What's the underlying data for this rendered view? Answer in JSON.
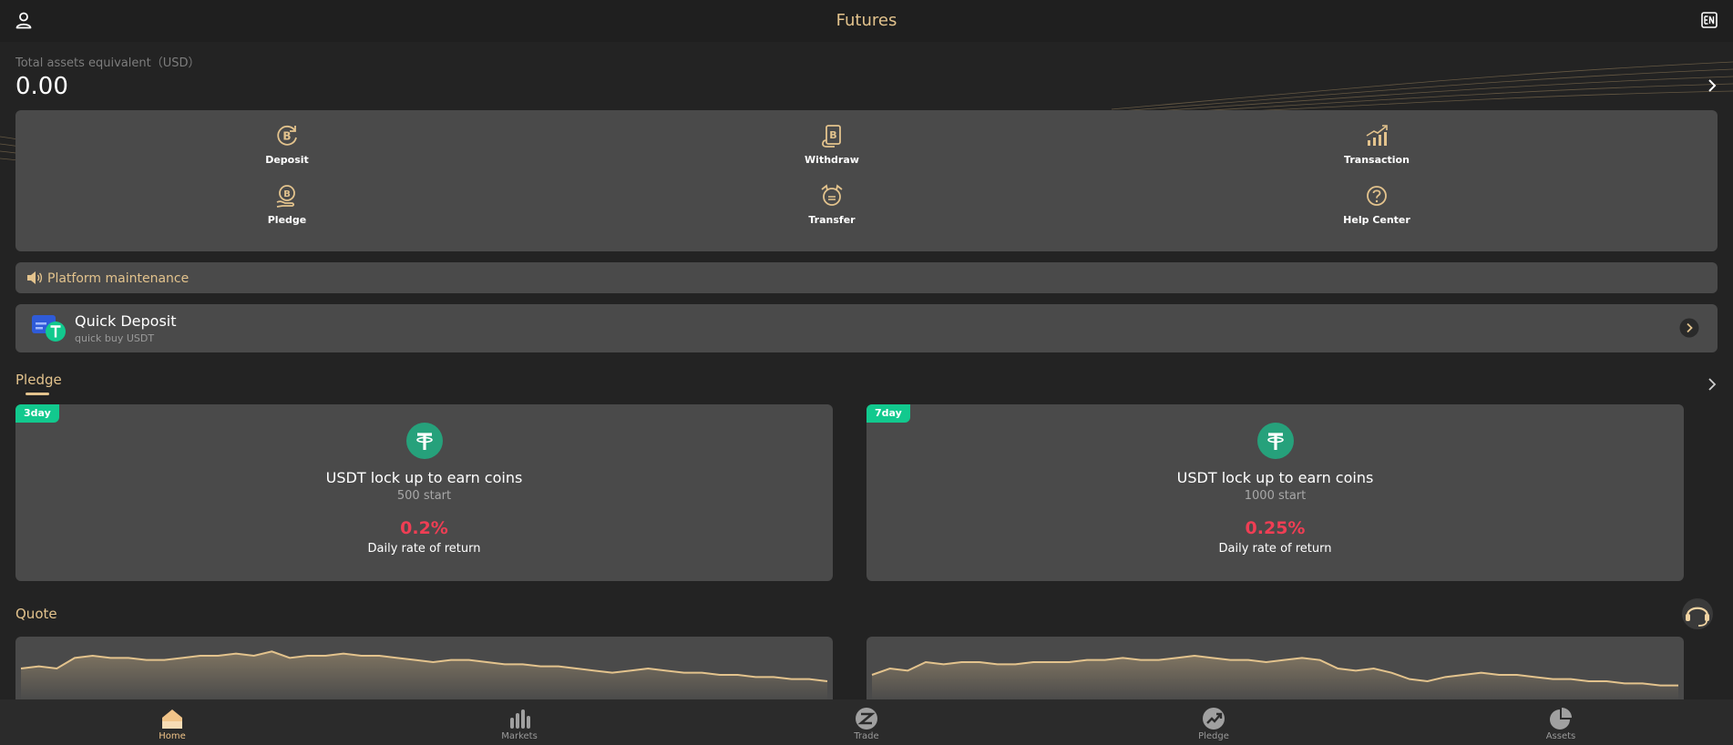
{
  "header": {
    "title": "Futures"
  },
  "assets": {
    "label": "Total assets equivalent（USD）",
    "value": "0.00"
  },
  "menu": {
    "items": [
      {
        "label": "Deposit",
        "icon": "bitcoin-refresh-icon"
      },
      {
        "label": "Withdraw",
        "icon": "bitcoin-wallet-icon"
      },
      {
        "label": "Transaction",
        "icon": "trend-chart-icon"
      },
      {
        "label": "Pledge",
        "icon": "bitcoin-hand-icon"
      },
      {
        "label": "Transfer",
        "icon": "transfer-cycle-icon"
      },
      {
        "label": "Help Center",
        "icon": "question-circle-icon"
      }
    ]
  },
  "notice": {
    "text": "Platform maintenance"
  },
  "quick_deposit": {
    "title": "Quick Deposit",
    "subtitle": "quick buy USDT"
  },
  "pledge": {
    "title": "Pledge",
    "cards": [
      {
        "tag": "3day",
        "title": "USDT lock up to earn coins",
        "subtitle": "500 start",
        "rate": "0.2%",
        "rate_label": "Daily rate of return"
      },
      {
        "tag": "7day",
        "title": "USDT lock up to earn coins",
        "subtitle": "1000 start",
        "rate": "0.25%",
        "rate_label": "Daily rate of return"
      }
    ]
  },
  "quote": {
    "title": "Quote",
    "sparklines": [
      {
        "values": [
          30,
          31,
          30,
          35,
          36,
          35,
          35,
          34,
          34,
          35,
          36,
          36,
          37,
          36,
          38,
          35,
          36,
          36,
          37,
          36,
          36,
          35,
          34,
          33,
          34,
          34,
          33,
          32,
          32,
          31,
          31,
          30,
          29,
          28,
          29,
          30,
          29,
          28,
          28,
          27,
          27,
          26,
          26,
          25,
          25,
          24
        ]
      },
      {
        "values": [
          27,
          30,
          29,
          33,
          32,
          33,
          33,
          32,
          32,
          33,
          33,
          33,
          34,
          34,
          35,
          34,
          34,
          35,
          36,
          35,
          34,
          34,
          33,
          34,
          35,
          34,
          30,
          29,
          30,
          28,
          25,
          24,
          26,
          27,
          28,
          27,
          27,
          26,
          25,
          25,
          24,
          24,
          23,
          23,
          22,
          22
        ]
      }
    ]
  },
  "tabbar": {
    "tabs": [
      {
        "label": "Home",
        "icon": "home-icon",
        "active": true
      },
      {
        "label": "Markets",
        "icon": "bar-chart-icon",
        "active": false
      },
      {
        "label": "Trade",
        "icon": "trade-icon",
        "active": false
      },
      {
        "label": "Pledge",
        "icon": "trend-up-icon",
        "active": false
      },
      {
        "label": "Assets",
        "icon": "pie-chart-icon",
        "active": false
      }
    ]
  },
  "colors": {
    "accent": "#e3c38d",
    "panel": "#4a4a4a",
    "background": "#232323",
    "rate": "#ef3e54",
    "tag": "#12c98e",
    "usdt": "#26a17b"
  }
}
